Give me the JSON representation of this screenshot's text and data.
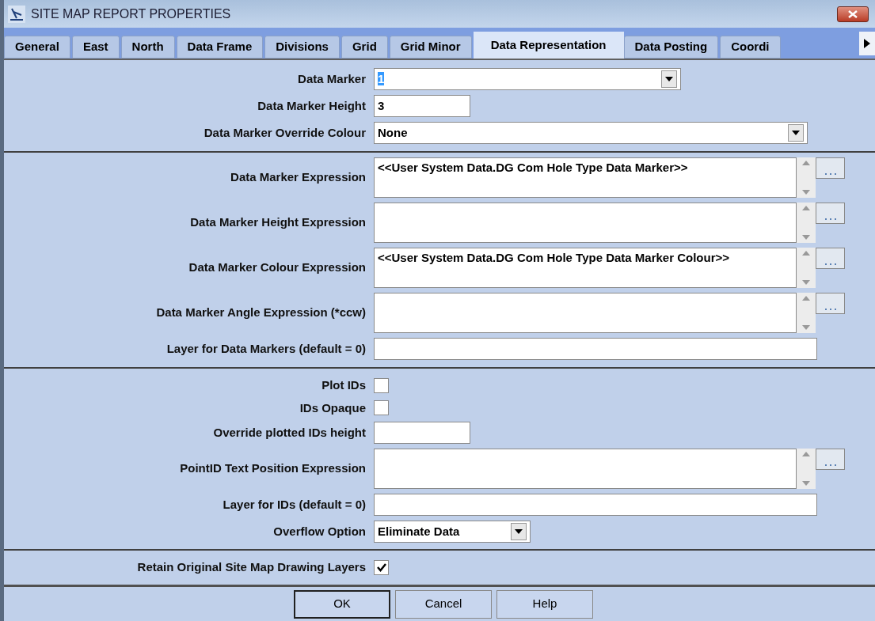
{
  "window": {
    "title": "SITE MAP REPORT PROPERTIES"
  },
  "tabs": [
    {
      "label": "General",
      "selected": false
    },
    {
      "label": "East",
      "selected": false
    },
    {
      "label": "North",
      "selected": false
    },
    {
      "label": "Data Frame",
      "selected": false
    },
    {
      "label": "Divisions",
      "selected": false
    },
    {
      "label": "Grid",
      "selected": false
    },
    {
      "label": "Grid Minor",
      "selected": false
    },
    {
      "label": "Data Representation",
      "selected": true
    },
    {
      "label": "Data Posting",
      "selected": false
    },
    {
      "label": "Coordi",
      "selected": false
    }
  ],
  "sections": [
    {
      "rows": [
        {
          "kind": "combo",
          "label": "Data Marker",
          "value": "1",
          "highlighted": true
        },
        {
          "kind": "text",
          "label": "Data Marker Height",
          "value": "3"
        },
        {
          "kind": "combo",
          "label": "Data Marker Override Colour",
          "value": "None",
          "highlighted": false
        }
      ]
    },
    {
      "rows": [
        {
          "kind": "expression",
          "label": "Data Marker Expression",
          "value": "<<User System Data.DG Com Hole Type Data Marker>>"
        },
        {
          "kind": "expression",
          "label": "Data Marker Height Expression"
        },
        {
          "kind": "expression",
          "label": "Data Marker Colour Expression",
          "value": "<<User System Data.DG Com Hole Type Data Marker Colour>>"
        },
        {
          "kind": "expression",
          "label": "Data Marker Angle Expression (*ccw)"
        },
        {
          "kind": "text",
          "label": "Layer for Data Markers (default = 0)"
        }
      ]
    },
    {
      "rows": [
        {
          "kind": "checkbox",
          "label": "Plot IDs",
          "checked": false
        },
        {
          "kind": "checkbox",
          "label": "IDs Opaque",
          "checked": false
        },
        {
          "kind": "text",
          "label": "Override plotted IDs height"
        },
        {
          "kind": "expression",
          "label": "PointID Text Position Expression"
        },
        {
          "kind": "text",
          "label": "Layer for IDs (default = 0)"
        },
        {
          "kind": "combo",
          "label": "Overflow Option",
          "value": "Eliminate Data",
          "highlighted": false
        }
      ]
    },
    {
      "rows": [
        {
          "kind": "checkbox",
          "label": "Retain Original Site Map Drawing Layers",
          "checked": true
        }
      ]
    }
  ],
  "buttons": [
    "OK",
    "Cancel",
    "Help"
  ]
}
